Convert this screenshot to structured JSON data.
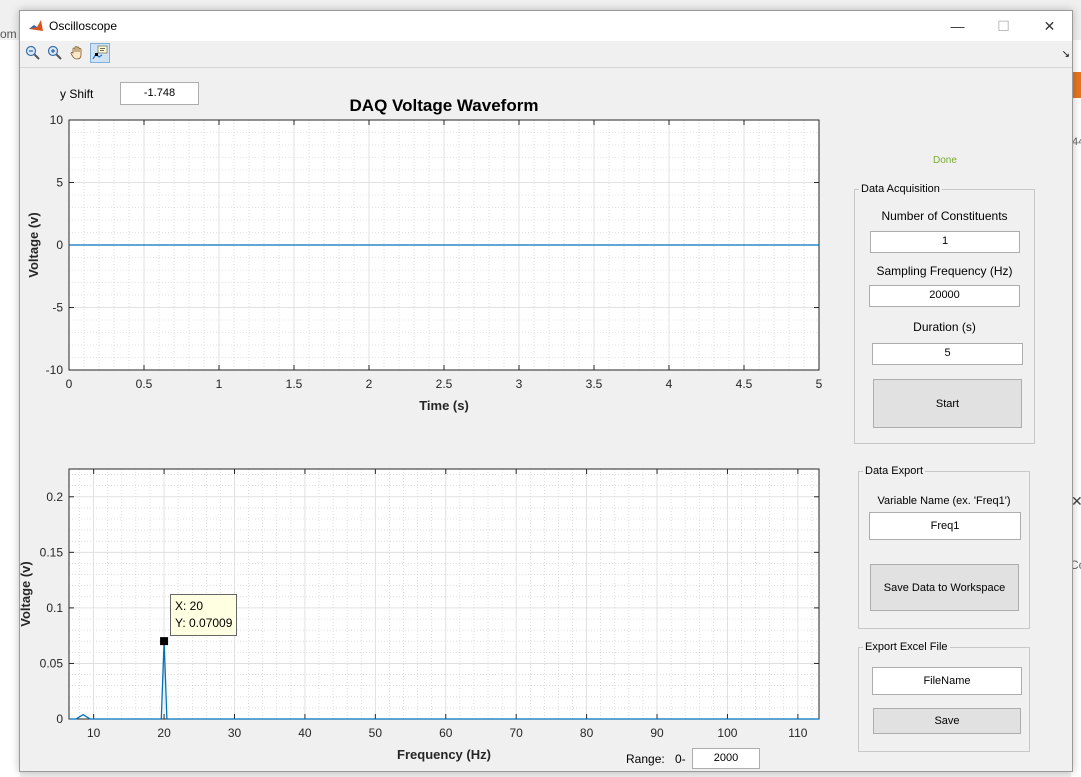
{
  "window": {
    "title": "Oscilloscope",
    "minimize": "—",
    "maximize": "☐",
    "close": "✕"
  },
  "background": {
    "left_fragment": "om",
    "right_fragment_1": "44",
    "right_fragment_2": "Co"
  },
  "toolbar": {
    "icons": [
      "zoom-out-icon",
      "zoom-in-icon",
      "pan-hand-icon",
      "data-cursor-icon"
    ]
  },
  "yshift": {
    "label": "y Shift",
    "value": "-1.748"
  },
  "status": {
    "text": "Done",
    "color": "#77ac30"
  },
  "acquisition": {
    "title": "Data Acquisition",
    "constituents_label": "Number of Constituents",
    "constituents_value": "1",
    "sampling_label": "Sampling Frequency (Hz)",
    "sampling_value": "20000",
    "duration_label": "Duration (s)",
    "duration_value": "5",
    "start_label": "Start"
  },
  "export": {
    "title": "Data Export",
    "varname_label": "Variable Name (ex. 'Freq1')",
    "varname_value": "Freq1",
    "save_ws_label": "Save Data to Workspace"
  },
  "excel": {
    "title": "Export Excel File",
    "filename_value": "FileName",
    "save_label": "Save"
  },
  "range": {
    "label": "Range:",
    "prefix": "0-",
    "value": "2000"
  },
  "datatip": {
    "x": "X: 20",
    "y": "Y: 0.07009"
  },
  "chart_data": [
    {
      "type": "line",
      "title": "DAQ Voltage Waveform",
      "xlabel": "Time (s)",
      "ylabel": "Voltage (v)",
      "xlim": [
        0,
        5
      ],
      "ylim": [
        -10,
        10
      ],
      "xticks": [
        "0",
        "0.5",
        "1",
        "1.5",
        "2",
        "2.5",
        "3",
        "3.5",
        "4",
        "4.5",
        "5"
      ],
      "yticks": [
        "10",
        "5",
        "0",
        "-5",
        "-10"
      ],
      "grid": "on",
      "minor_grid": "on",
      "line_color": "#0072bd",
      "series": [
        {
          "x": [
            0,
            5
          ],
          "y": [
            0,
            0
          ]
        }
      ]
    },
    {
      "type": "line",
      "title": "",
      "xlabel": "Frequency (Hz)",
      "ylabel": "Voltage (v)",
      "xlim": [
        6.5,
        113
      ],
      "ylim": [
        0,
        0.225
      ],
      "xticks": [
        "10",
        "20",
        "30",
        "40",
        "50",
        "60",
        "70",
        "80",
        "90",
        "100",
        "110"
      ],
      "yticks": [
        "0.2",
        "0.15",
        "0.1",
        "0.05",
        "0"
      ],
      "grid": "on",
      "minor_grid": "on",
      "line_color": "#0072bd",
      "series": [
        {
          "x": [
            6.5,
            7.5,
            8.0,
            8.5,
            9.0,
            9.5,
            10.5,
            19.6,
            20,
            20.4,
            21,
            113
          ],
          "y": [
            0,
            0,
            0.002,
            0.004,
            0.002,
            0,
            0,
            0,
            0.07009,
            0,
            0,
            0
          ]
        }
      ],
      "datatip_point": {
        "x": 20,
        "y": 0.07009
      }
    }
  ]
}
